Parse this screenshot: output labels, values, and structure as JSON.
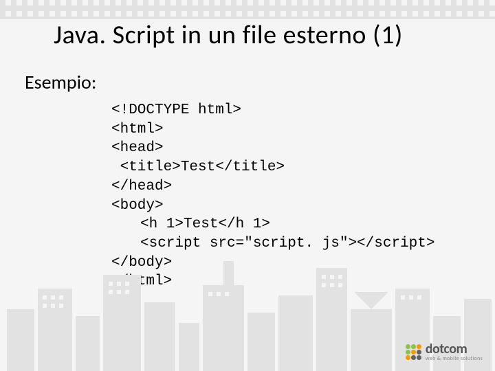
{
  "title": "Java. Script in un file esterno (1)",
  "subtitle": "Esempio:",
  "code": {
    "l1": "<!DOCTYPE html>",
    "l2": "<html>",
    "l3": "<head>",
    "l4": " <title>Test</title>",
    "l5": "</head>",
    "l6": "<body>",
    "l7": "<h 1>Test</h 1>",
    "l8": "<script src=\"script. js\"></script>",
    "l9": "</body>",
    "l10": "</html>"
  },
  "logo": {
    "name": "dotcom",
    "tagline": "web & mobile solutions"
  }
}
